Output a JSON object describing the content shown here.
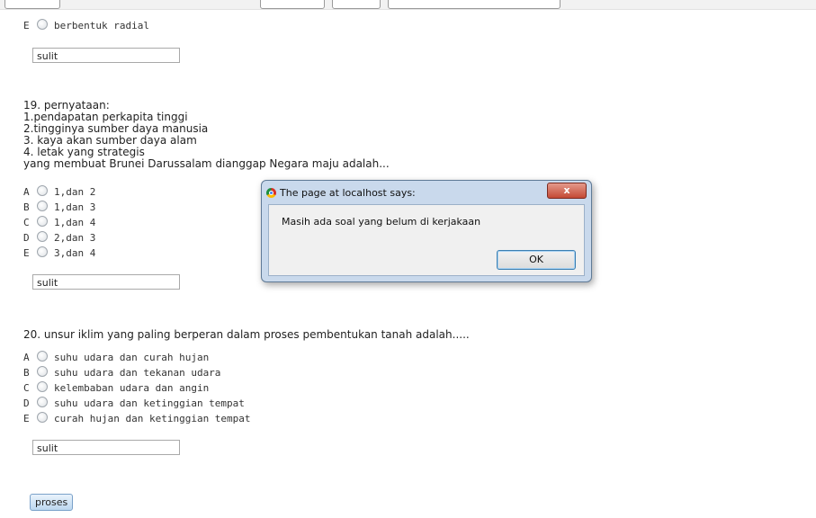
{
  "q18": {
    "options": [
      {
        "letter": "E",
        "text": "berbentuk radial"
      }
    ],
    "answer_value": "sulit"
  },
  "q19": {
    "lines": [
      "19. pernyataan:",
      "1.pendapatan perkapita tinggi",
      "2.tingginya sumber daya manusia",
      "3. kaya akan sumber daya alam",
      "4. letak yang strategis",
      "yang membuat Brunei Darussalam dianggap Negara maju adalah..."
    ],
    "options": [
      {
        "letter": "A",
        "text": "1,dan 2"
      },
      {
        "letter": "B",
        "text": "1,dan 3"
      },
      {
        "letter": "C",
        "text": "1,dan 4"
      },
      {
        "letter": "D",
        "text": "2,dan 3"
      },
      {
        "letter": "E",
        "text": "3,dan 4"
      }
    ],
    "answer_value": "sulit"
  },
  "q20": {
    "question": "20. unsur iklim yang paling berperan dalam proses pembentukan tanah adalah.....",
    "options": [
      {
        "letter": "A",
        "text": "suhu udara dan curah hujan"
      },
      {
        "letter": "B",
        "text": "suhu udara dan tekanan udara"
      },
      {
        "letter": "C",
        "text": "kelembaban udara dan angin"
      },
      {
        "letter": "D",
        "text": "suhu udara dan ketinggian tempat"
      },
      {
        "letter": "E",
        "text": "curah hujan dan ketinggian tempat"
      }
    ],
    "answer_value": "sulit"
  },
  "submit_label": "proses",
  "dialog": {
    "title": "The page at localhost says:",
    "message": "Masih ada soal yang belum di kerjakaan",
    "ok_label": "OK",
    "close_label": "x",
    "icon": "chrome-icon"
  }
}
